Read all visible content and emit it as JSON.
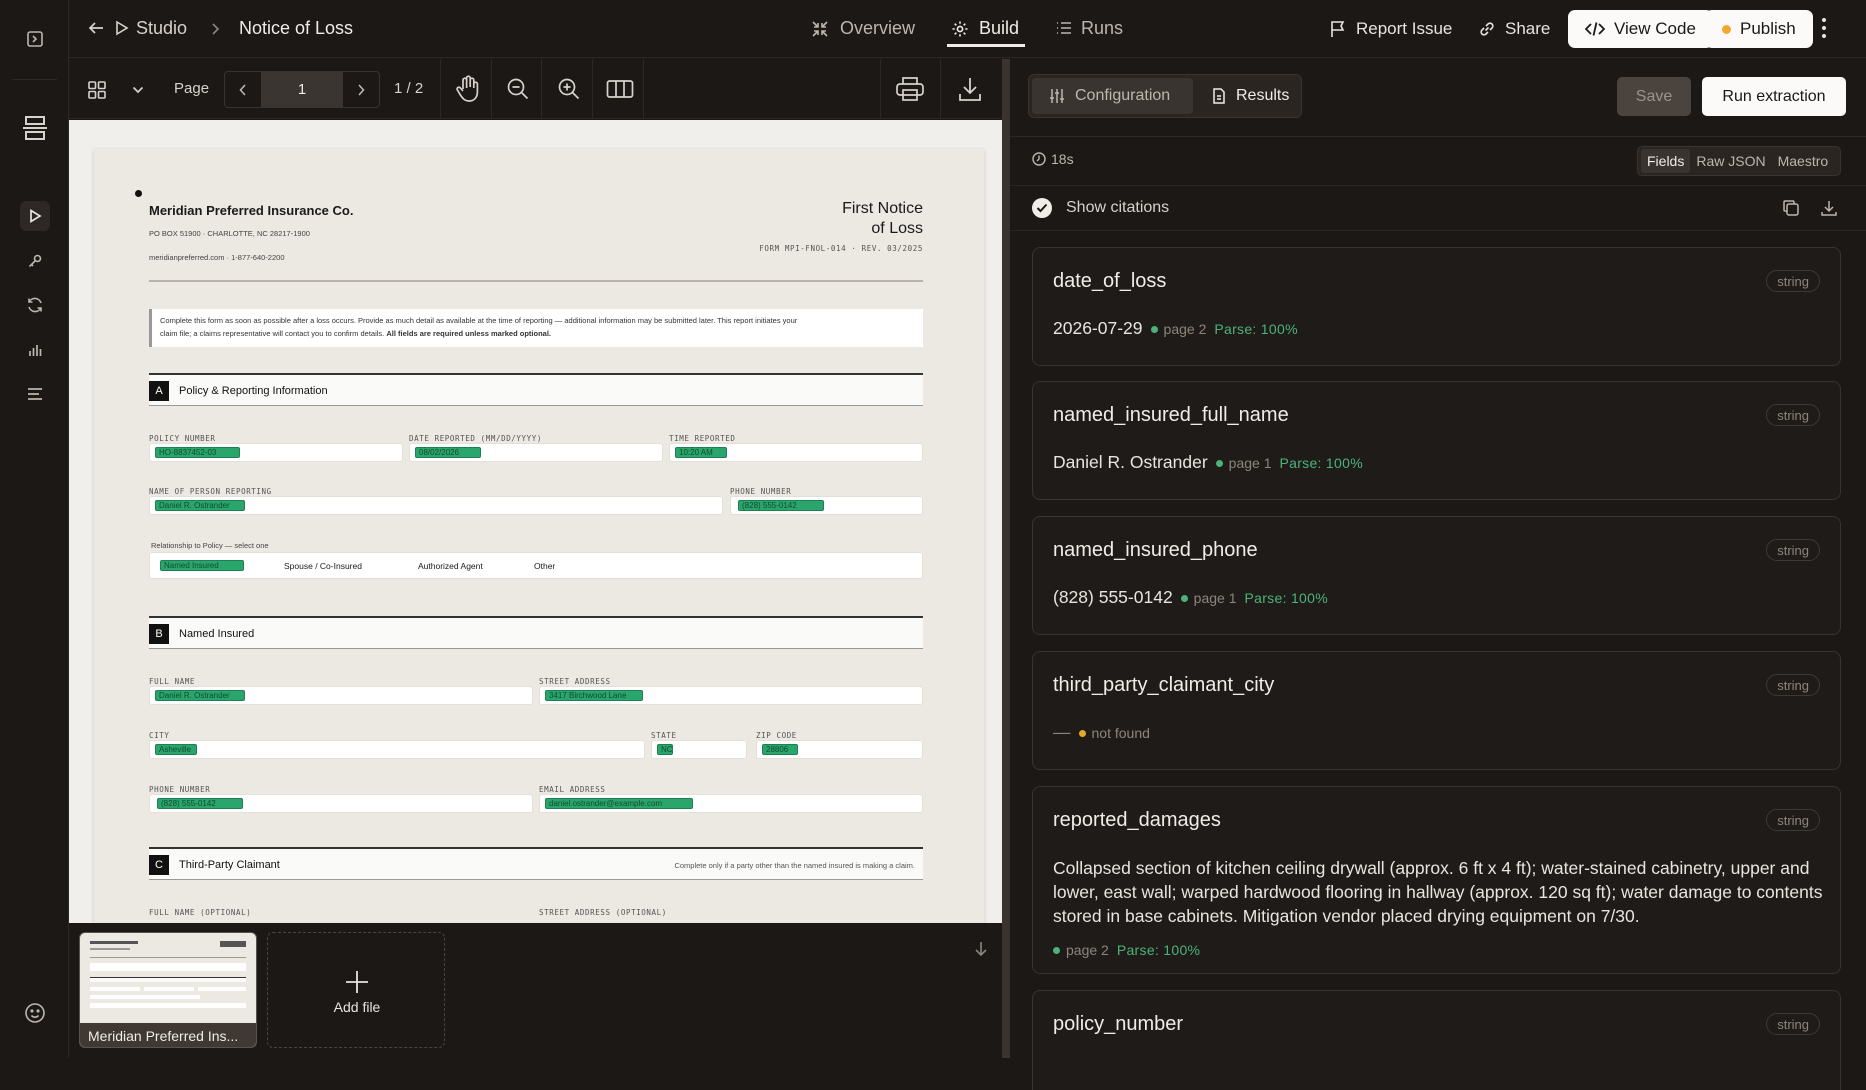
{
  "nav": {
    "back_label": "Studio",
    "doc_title": "Notice of Loss",
    "tabs": [
      {
        "label": "Overview"
      },
      {
        "label": "Build"
      },
      {
        "label": "Runs"
      }
    ],
    "report_issue": "Report Issue",
    "share": "Share",
    "view_code": "View Code",
    "publish": "Publish"
  },
  "viewer": {
    "page_label": "Page",
    "page_value": "1",
    "page_count": "1 / 2"
  },
  "doc": {
    "company": "Meridian Preferred Insurance Co.",
    "address": "PO BOX 51900 · CHARLOTTE, NC 28217-1900",
    "contact": "meridianpreferred.com · 1-877-640-2200",
    "title_line1": "First Notice",
    "title_line2": "of Loss",
    "form_id": "FORM MPI-FNOL-014 · REV. 03/2025",
    "instructions": "Complete this form as soon as possible after a loss occurs. Provide as much detail as available at the time of reporting — additional information may be submitted later. This report initiates your",
    "instructions2": "claim file; a claims representative will contact you to confirm details.",
    "instructions_bold": "All fields are required unless marked optional.",
    "sec_a_letter": "A",
    "sec_a": "Policy & Reporting Information",
    "policy_number_label": "POLICY NUMBER",
    "policy_number": "HO-8837452-03",
    "date_reported_label": "DATE REPORTED (MM/DD/YYYY)",
    "date_reported": "08/02/2026",
    "time_reported_label": "TIME REPORTED",
    "time_reported": "10:20 AM",
    "person_reporting_label": "NAME OF PERSON REPORTING",
    "person_reporting": "Daniel R. Ostrander",
    "phone_label": "PHONE NUMBER",
    "phone": "(828) 555-0142",
    "relationship_label": "Relationship to Policy — select one",
    "rel_opt1": "Named Insured",
    "rel_opt2": "Spouse / Co-Insured",
    "rel_opt3": "Authorized Agent",
    "rel_opt4": "Other",
    "sec_b_letter": "B",
    "sec_b": "Named Insured",
    "full_name_label": "FULL NAME",
    "full_name": "Daniel R. Ostrander",
    "street_label": "STREET ADDRESS",
    "street": "3417 Birchwood Lane",
    "city_label": "CITY",
    "city": "Asheville",
    "state_label": "STATE",
    "state": "NC",
    "zip_label": "ZIP CODE",
    "zip": "28806",
    "ni_phone_label": "PHONE NUMBER",
    "ni_phone": "(828) 555-0142",
    "email_label": "EMAIL ADDRESS",
    "email": "daniel.ostrander@example.com",
    "sec_c_letter": "C",
    "sec_c": "Third-Party Claimant",
    "sec_c_note": "Complete only if a party other than the named insured is making a claim.",
    "tp_name_label": "FULL NAME (OPTIONAL)",
    "tp_street_label": "STREET ADDRESS (OPTIONAL)"
  },
  "thumbs": {
    "file_name": "Meridian Preferred Ins...",
    "add_file": "Add file"
  },
  "panel": {
    "tab_config": "Configuration",
    "tab_results": "Results",
    "save": "Save",
    "run": "Run extraction",
    "elapsed": "18s",
    "view_fields": "Fields",
    "view_raw": "Raw JSON",
    "view_maestro": "Maestro",
    "show_citations": "Show citations",
    "colors": {
      "found": "#4bb37a",
      "missing": "#e0a92f"
    },
    "fields": [
      {
        "name": "date_of_loss",
        "type": "string",
        "value": "2026-07-29",
        "page": "page 2",
        "parse": "Parse: 100%"
      },
      {
        "name": "named_insured_full_name",
        "type": "string",
        "value": "Daniel R. Ostrander",
        "page": "page 1",
        "parse": "Parse: 100%"
      },
      {
        "name": "named_insured_phone",
        "type": "string",
        "value": "(828) 555-0142",
        "page": "page 1",
        "parse": "Parse: 100%"
      },
      {
        "name": "third_party_claimant_city",
        "type": "string",
        "value": "—",
        "page": "not found",
        "parse": ""
      },
      {
        "name": "reported_damages",
        "type": "string",
        "value": "Collapsed section of kitchen ceiling drywall (approx. 6 ft x 4 ft); water-stained cabinetry, upper and lower, east wall; warped hardwood flooring in hallway (approx. 120 sq ft); water damage to contents stored in base cabinets. Mitigation vendor placed drying equipment on 7/30.",
        "page": "page 2",
        "parse": "Parse: 100%"
      },
      {
        "name": "policy_number",
        "type": "string",
        "value": "",
        "page": "",
        "parse": ""
      }
    ]
  }
}
